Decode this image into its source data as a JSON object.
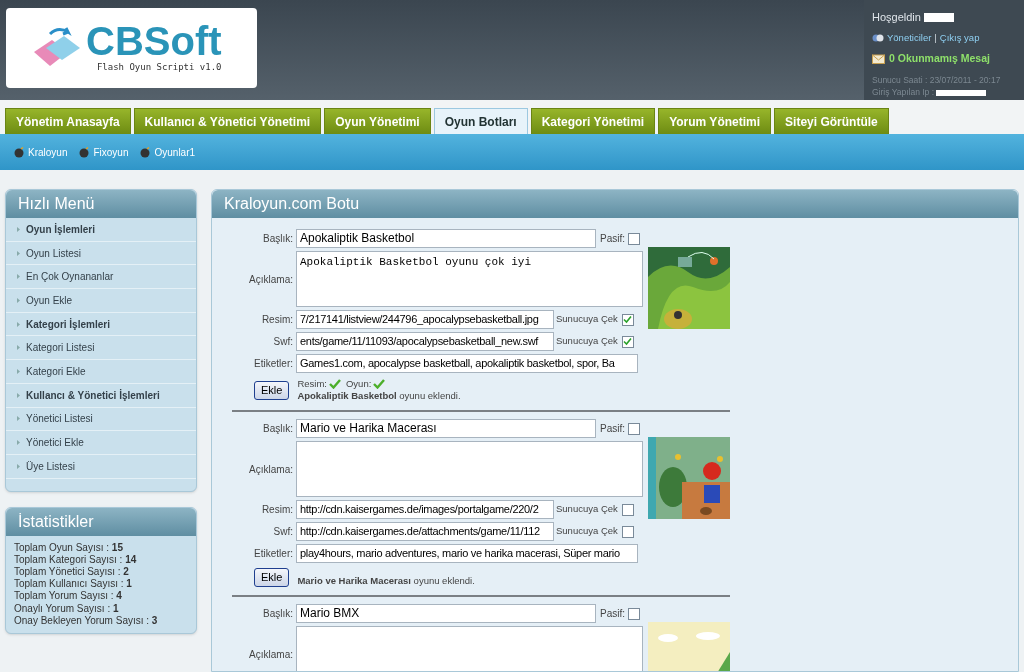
{
  "logo": {
    "name": "CBSoft",
    "subtitle": "Flash Oyun Scripti v1.0"
  },
  "user_panel": {
    "greeting": "Hoşgeldin",
    "links": [
      "Yöneticiler",
      "|",
      "Çıkış yap"
    ],
    "messages": "0 Okunmamış Mesaj",
    "server_time": "Sunucu Saati : 23/07/2011 - 20:17",
    "login_ip": "Giriş Yapılan Ip :"
  },
  "tabs": [
    {
      "label": "Yönetim Anasayfa",
      "selected": false
    },
    {
      "label": "Kullanıcı & Yönetici Yönetimi",
      "selected": false
    },
    {
      "label": "Oyun Yönetimi",
      "selected": false
    },
    {
      "label": "Oyun Botları",
      "selected": true
    },
    {
      "label": "Kategori Yönetimi",
      "selected": false
    },
    {
      "label": "Yorum Yönetimi",
      "selected": false
    },
    {
      "label": "Siteyi Görüntüle",
      "selected": false
    }
  ],
  "sub_nav": [
    "Kraloyun",
    "Fixoyun",
    "Oyunlar1"
  ],
  "quick_menu": {
    "title": "Hızlı Menü",
    "items": [
      {
        "label": "Oyun İşlemleri",
        "kind": "section"
      },
      {
        "label": "Oyun Listesi",
        "kind": "link"
      },
      {
        "label": "En Çok Oynananlar",
        "kind": "link"
      },
      {
        "label": "Oyun Ekle",
        "kind": "link"
      },
      {
        "label": "Kategori İşlemleri",
        "kind": "section"
      },
      {
        "label": "Kategori Listesi",
        "kind": "link"
      },
      {
        "label": "Kategori Ekle",
        "kind": "link"
      },
      {
        "label": "Kullancı & Yönetici İşlemleri",
        "kind": "section"
      },
      {
        "label": "Yönetici Listesi",
        "kind": "link"
      },
      {
        "label": "Yönetici Ekle",
        "kind": "link"
      },
      {
        "label": "Üye Listesi",
        "kind": "link"
      }
    ]
  },
  "stats": {
    "title": "İstatistikler",
    "rows": [
      {
        "label": "Toplam Oyun Sayısı :",
        "value": "15"
      },
      {
        "label": "Toplam Kategori Sayısı :",
        "value": "14"
      },
      {
        "label": "Toplam Yönetici Sayısı :",
        "value": "2"
      },
      {
        "label": "Toplam Kullanıcı Sayısı :",
        "value": "1"
      },
      {
        "label": "Toplam Yorum Sayısı :",
        "value": "4"
      },
      {
        "label": "Onaylı Yorum Sayısı :",
        "value": "1"
      },
      {
        "label": "Onay Bekleyen Yorum Sayısı :",
        "value": "3"
      }
    ]
  },
  "main": {
    "title": "Kraloyun.com Botu",
    "games": [
      {
        "labels": {
          "title": "Başlık:",
          "passive": "Pasif:",
          "description": "Açıklama:",
          "image": "Resim:",
          "image_fetch": "Sunucuya Çek",
          "swf": "Swf:",
          "swf_fetch": "Sunucuya Çek",
          "tags": "Etiketler:",
          "button": "Ekle",
          "image_status": "Resim:",
          "game_status": "Oyun:"
        },
        "title": "Apokaliptik Basketbol",
        "passive": false,
        "description": "Apokaliptik Basketbol oyunu çok iyi",
        "image_url": "7/217141/listview/244796_apocalypsebasketball.jpg",
        "image_fetch": true,
        "swf_url": "ents/game/11/11093/apocalypsebasketball_new.swf",
        "swf_fetch": true,
        "tags": "Games1.com, apocalypse basketball, apokaliptik basketbol, spor, Ba",
        "image_ok": true,
        "game_ok": true,
        "message": "**Apokaliptik Basketbol** oyunu eklendi."
      },
      {
        "labels": {
          "title": "Başlık:",
          "passive": "Pasif:",
          "description": "Açıklama:",
          "image": "Resim:",
          "image_fetch": "Sunucuya Çek",
          "swf": "Swf:",
          "swf_fetch": "Sunucuya Çek",
          "tags": "Etiketler:",
          "button": "Ekle"
        },
        "title": "Mario ve Harika Macerası",
        "passive": false,
        "image_url": "http://cdn.kaisergames.de/images/portalgame/220/2",
        "image_fetch": false,
        "swf_url": "http://cdn.kaisergames.de/attachments/game/11/112",
        "swf_fetch": false,
        "tags": "play4hours, mario adventures, mario ve harika macerasi, Süper mario",
        "image_ok": false,
        "game_ok": false,
        "message": "**Mario ve Harika Macerası** oyunu eklendi."
      },
      {
        "labels": {
          "title": "Başlık:",
          "passive": "Pasif:",
          "description": "Açıklama:"
        },
        "title": "Mario BMX",
        "passive": false
      }
    ]
  }
}
